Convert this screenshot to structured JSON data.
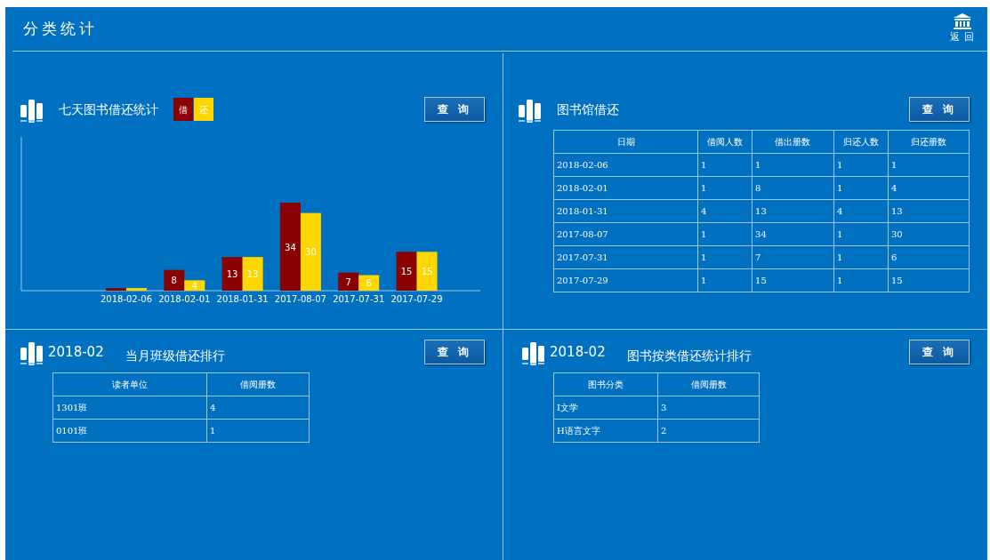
{
  "header": {
    "title": "分类统计",
    "back_label": "返 回"
  },
  "panels": [
    {
      "kind": "chart",
      "title": "七天图书借还统计",
      "button": "查 询",
      "chart_data": {
        "type": "bar",
        "categories": [
          "2018-02-06",
          "2018-02-01",
          "2018-01-31",
          "2017-08-07",
          "2017-07-31",
          "2017-07-29"
        ],
        "series": [
          {
            "name": "借",
            "color": "#8b0000",
            "values": [
              1,
              8,
              13,
              34,
              7,
              15
            ],
            "value_labels": [
              null,
              "8",
              "13",
              "34",
              "7",
              "15"
            ]
          },
          {
            "name": "还",
            "color": "#ffd700",
            "values": [
              1,
              4,
              13,
              30,
              6,
              15
            ],
            "value_labels": [
              null,
              "4",
              "13",
              "30",
              "6",
              "15"
            ]
          }
        ]
      }
    },
    {
      "kind": "table",
      "title": "图书馆借还",
      "button": "查 询",
      "table": {
        "columns": [
          "日期",
          "借阅人数",
          "借出册数",
          "归还人数",
          "归还册数"
        ],
        "rows": [
          [
            "2018-02-06",
            "1",
            "1",
            "1",
            "1"
          ],
          [
            "2018-02-01",
            "1",
            "8",
            "1",
            "4"
          ],
          [
            "2018-01-31",
            "4",
            "13",
            "4",
            "13"
          ],
          [
            "2017-08-07",
            "1",
            "34",
            "1",
            "30"
          ],
          [
            "2017-07-31",
            "1",
            "7",
            "1",
            "6"
          ],
          [
            "2017-07-29",
            "1",
            "15",
            "1",
            "15"
          ]
        ]
      }
    },
    {
      "kind": "table",
      "period": "2018-02",
      "title": "当月班级借还排行",
      "button": "查 询",
      "table": {
        "columns": [
          "读者单位",
          "借阅册数"
        ],
        "rows": [
          [
            "1301班",
            "4"
          ],
          [
            "0101班",
            "1"
          ]
        ]
      }
    },
    {
      "kind": "table",
      "period": "2018-02",
      "title": "图书按类借还统计排行",
      "button": "查 询",
      "table": {
        "columns": [
          "图书分类",
          "借阅册数"
        ],
        "rows": [
          [
            "I文学",
            "3"
          ],
          [
            "H语言文字",
            "2"
          ]
        ]
      }
    }
  ]
}
